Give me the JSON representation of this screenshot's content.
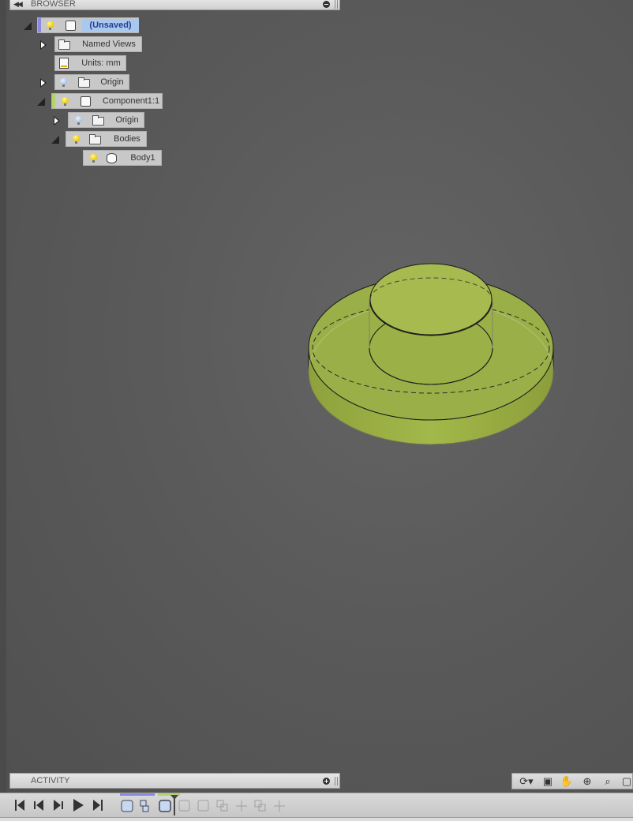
{
  "browser": {
    "title": "BROWSER",
    "collapse_glyph": "◀◀",
    "root": {
      "label": "(Unsaved)",
      "icon": "component-icon",
      "accent": "#8a8ae0",
      "selected_bg": "#a9c8f0"
    },
    "items": [
      {
        "label": "Named Views",
        "icon": "folder-icon",
        "expand": "collapsed"
      },
      {
        "label": "Units: mm",
        "icon": "document-settings-icon",
        "expand": "none"
      },
      {
        "label": "Origin",
        "icon": "folder-icon",
        "bulb": "off",
        "expand": "collapsed"
      },
      {
        "label": "Component1:1",
        "icon": "component-icon",
        "bulb": "on",
        "expand": "expanded",
        "accent": "#b4d36a"
      },
      {
        "label": "Origin",
        "icon": "folder-icon",
        "bulb": "off",
        "expand": "collapsed"
      },
      {
        "label": "Bodies",
        "icon": "folder-icon",
        "bulb": "on",
        "expand": "expanded"
      },
      {
        "label": "Body1",
        "icon": "body-icon",
        "bulb": "on",
        "expand": "none"
      }
    ]
  },
  "activity": {
    "title": "ACTIVITY"
  },
  "timeline": {
    "controls": [
      "go-to-start",
      "step-back",
      "play-back",
      "play",
      "go-to-end"
    ],
    "features": [
      "extrude-1",
      "sketch-1",
      "extrude-2",
      "feature-inactive-1",
      "feature-inactive-2",
      "feature-inactive-3",
      "feature-inactive-4",
      "feature-inactive-5",
      "feature-inactive-6"
    ]
  },
  "nav_toolbar": [
    "orbit-icon",
    "look-at-icon",
    "pan-icon",
    "zoom-icon",
    "fit-icon",
    "display-settings-icon"
  ],
  "model": {
    "color": "#a8c24a",
    "edge_color": "#1a1a1a"
  }
}
